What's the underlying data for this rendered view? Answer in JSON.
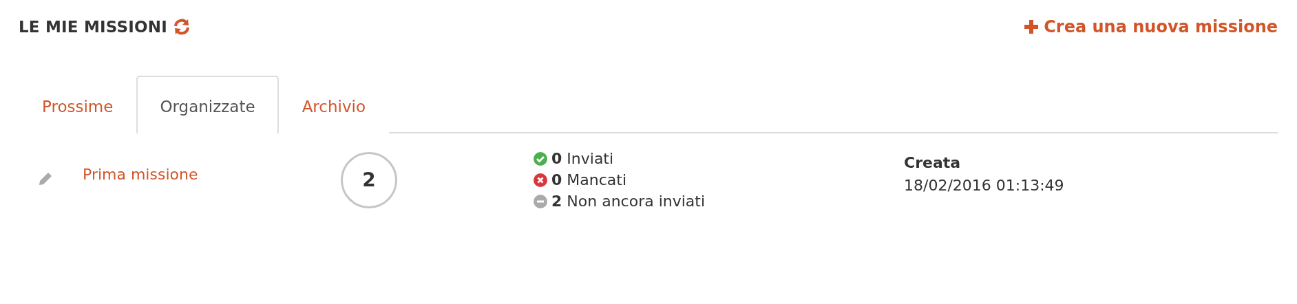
{
  "header": {
    "title": "LE MIE MISSIONI",
    "create_link": "Crea una nuova missione"
  },
  "tabs": [
    {
      "label": "Prossime",
      "selected": false
    },
    {
      "label": "Organizzate",
      "selected": true
    },
    {
      "label": "Archivio",
      "selected": false
    }
  ],
  "missions": [
    {
      "name": "Prima missione",
      "count": "2",
      "statuses": [
        {
          "kind": "sent",
          "count": "0",
          "label": "Inviati"
        },
        {
          "kind": "missed",
          "count": "0",
          "label": "Mancati"
        },
        {
          "kind": "pending",
          "count": "2",
          "label": "Non ancora inviati"
        }
      ],
      "created_label": "Creata",
      "created_at": "18/02/2016 01:13:49"
    }
  ]
}
